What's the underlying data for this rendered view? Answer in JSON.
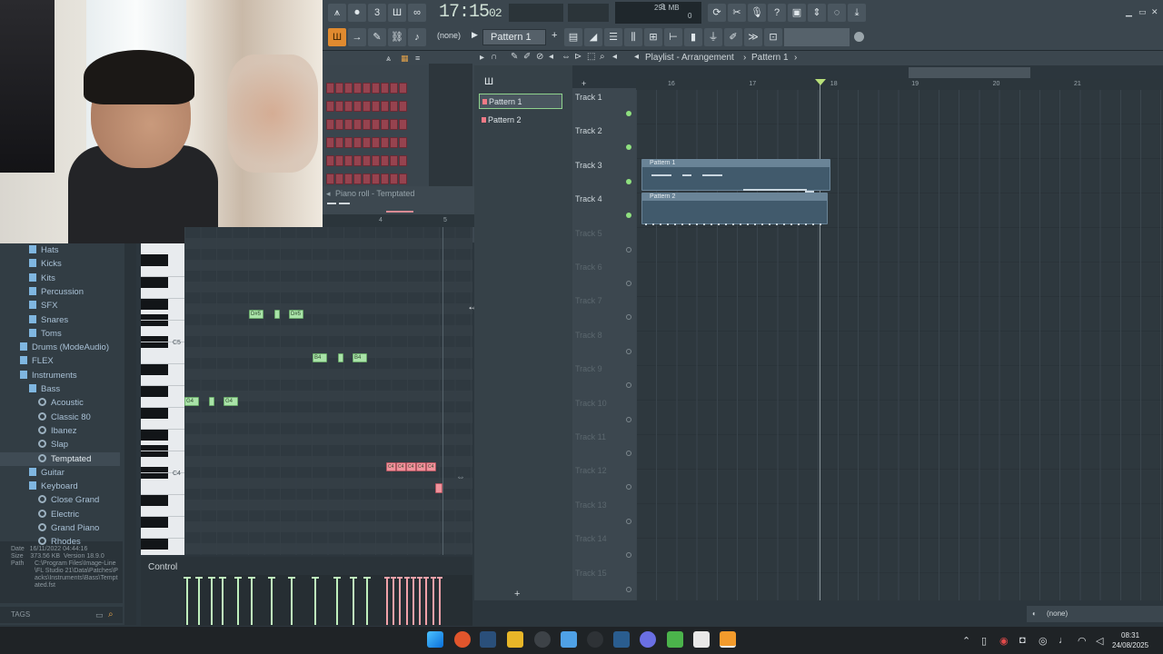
{
  "toolbar": {
    "time_main": "17:15",
    "time_sub": "02",
    "pattern_label": "Pattern 1",
    "snap_value": "(none)",
    "memory": "291 MB",
    "voices_a": "3",
    "voices_b": "0"
  },
  "piano_roll": {
    "title": "Piano roll - Temptated",
    "ruler": [
      "4",
      "5"
    ],
    "key_c5": "C5",
    "key_c4": "C4",
    "control_label": "Control",
    "notes_green": [
      {
        "label": "D#5"
      },
      {
        "label": ""
      },
      {
        "label": "D#5"
      },
      {
        "label": "B4"
      },
      {
        "label": ""
      },
      {
        "label": "B4"
      },
      {
        "label": "G4"
      },
      {
        "label": ""
      },
      {
        "label": "G4"
      }
    ],
    "notes_pink": [
      {
        "label": "C4"
      },
      {
        "label": "C4"
      },
      {
        "label": "C4"
      },
      {
        "label": "C4"
      },
      {
        "label": "C4"
      }
    ]
  },
  "browser": {
    "items": [
      {
        "label": "Hats",
        "type": "folder"
      },
      {
        "label": "Kicks",
        "type": "folder"
      },
      {
        "label": "Kits",
        "type": "folder"
      },
      {
        "label": "Percussion",
        "type": "folder"
      },
      {
        "label": "SFX",
        "type": "folder"
      },
      {
        "label": "Snares",
        "type": "folder"
      },
      {
        "label": "Toms",
        "type": "folder"
      },
      {
        "label": "Drums (ModeAudio)",
        "type": "folder"
      },
      {
        "label": "FLEX",
        "type": "folder"
      },
      {
        "label": "Instruments",
        "type": "folder"
      },
      {
        "label": "Bass",
        "type": "folder"
      },
      {
        "label": "Acoustic",
        "type": "preset"
      },
      {
        "label": "Classic 80",
        "type": "preset"
      },
      {
        "label": "Ibanez",
        "type": "preset"
      },
      {
        "label": "Slap",
        "type": "preset"
      },
      {
        "label": "Temptated",
        "type": "preset"
      },
      {
        "label": "Guitar",
        "type": "folder"
      },
      {
        "label": "Keyboard",
        "type": "folder"
      },
      {
        "label": "Close Grand",
        "type": "preset"
      },
      {
        "label": "Electric",
        "type": "preset"
      },
      {
        "label": "Grand Piano",
        "type": "preset"
      },
      {
        "label": "Rhodes",
        "type": "preset"
      }
    ],
    "info": {
      "date_label": "Date",
      "date": "16/11/2022 04:44:16",
      "size_label": "Size",
      "size": "373.56 KB",
      "version_label": "Version",
      "version": "18.9.0",
      "path_label": "Path",
      "path": "C:\\Program Files\\Image-Line\\FL Studio 21\\Data\\Patches\\Packs\\Instruments\\Bass\\Temptated.fst"
    },
    "tags_label": "TAGS"
  },
  "playlist": {
    "title": "Playlist - Arrangement",
    "pattern_crumb": "Pattern 1",
    "patterns": [
      "Pattern 1",
      "Pattern 2"
    ],
    "ruler": [
      "16",
      "17",
      "18",
      "19",
      "20",
      "21"
    ],
    "tracks": [
      "Track 1",
      "Track 2",
      "Track 3",
      "Track 4",
      "Track 5",
      "Track 6",
      "Track 7",
      "Track 8",
      "Track 9",
      "Track 10",
      "Track 11",
      "Track 12",
      "Track 13",
      "Track 14",
      "Track 15"
    ],
    "clips": [
      {
        "label": "Pattern 1",
        "track": 3
      },
      {
        "label": "Pattern 2",
        "track": 4
      }
    ],
    "bottom_value": "(none)"
  },
  "taskbar": {
    "time": "08:31",
    "date": "24/08/2025"
  },
  "colors": {
    "accent_green": "#a9e3a8",
    "note_pink": "#f0929b",
    "track_active": "#8fe07f"
  }
}
